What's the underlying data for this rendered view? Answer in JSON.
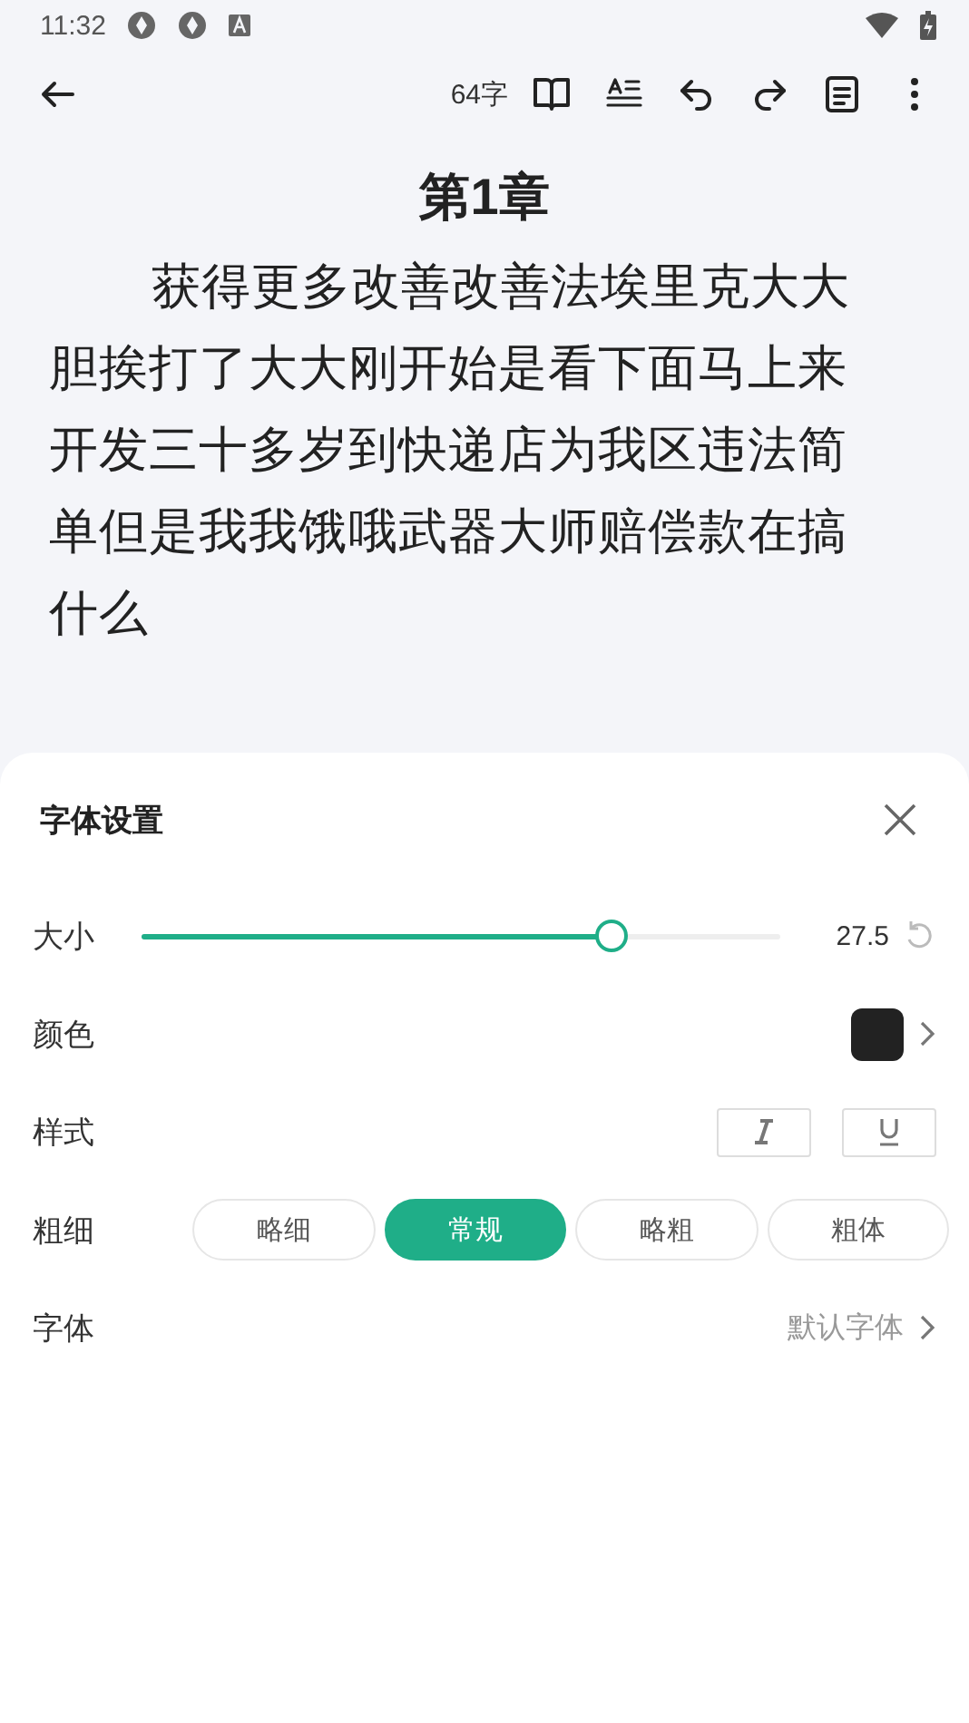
{
  "status_bar": {
    "time": "11:32"
  },
  "toolbar": {
    "word_count": "64字"
  },
  "chapter": {
    "title": "第1章",
    "body": "获得更多改善改善法埃里克大大胆挨打了大大刚开始是看下面马上来开发三十多岁到快递店为我区违法简单但是我我饿哦武器大师赔偿款在搞什么"
  },
  "font_panel": {
    "title": "字体设置",
    "size": {
      "label": "大小",
      "level": 0.735,
      "reading": "27.5"
    },
    "color": {
      "label": "颜色",
      "color": "#222222"
    },
    "style": {
      "label": "样式",
      "italic": false,
      "underline": false
    },
    "weight": {
      "label": "粗细",
      "options": [
        {
          "label": "略细",
          "selected": false
        },
        {
          "label": "常规",
          "selected": true
        },
        {
          "label": "略粗",
          "selected": false
        },
        {
          "label": "粗体",
          "selected": false
        }
      ]
    },
    "font": {
      "label": "字体",
      "value": "默认字体"
    }
  }
}
